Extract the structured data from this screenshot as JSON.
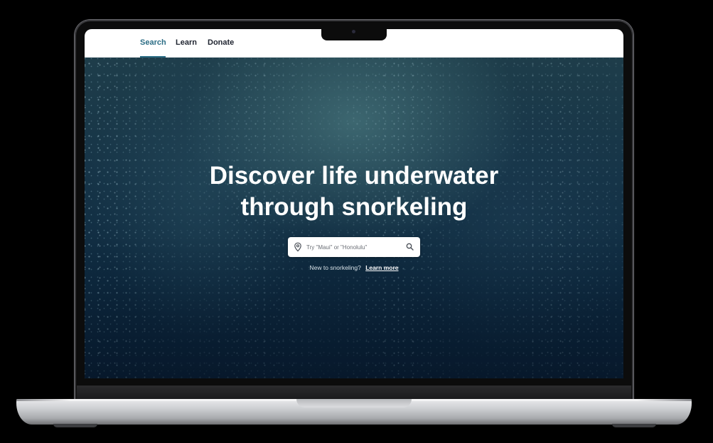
{
  "nav": {
    "items": [
      {
        "label": "Search",
        "active": true
      },
      {
        "label": "Learn",
        "active": false
      },
      {
        "label": "Donate",
        "active": false
      }
    ],
    "accent_color": "#2d6e86"
  },
  "hero": {
    "headline_line1": "Discover life underwater",
    "headline_line2": "through snorkeling",
    "search": {
      "placeholder": "Try \"Maui\" or \"Honolulu\"",
      "value": "",
      "leading_icon": "location-pin-icon",
      "trailing_icon": "search-icon"
    },
    "prompt_text": "New to snorkeling?",
    "learn_more_label": "Learn more"
  },
  "device": {
    "type": "laptop",
    "color": "silver"
  }
}
